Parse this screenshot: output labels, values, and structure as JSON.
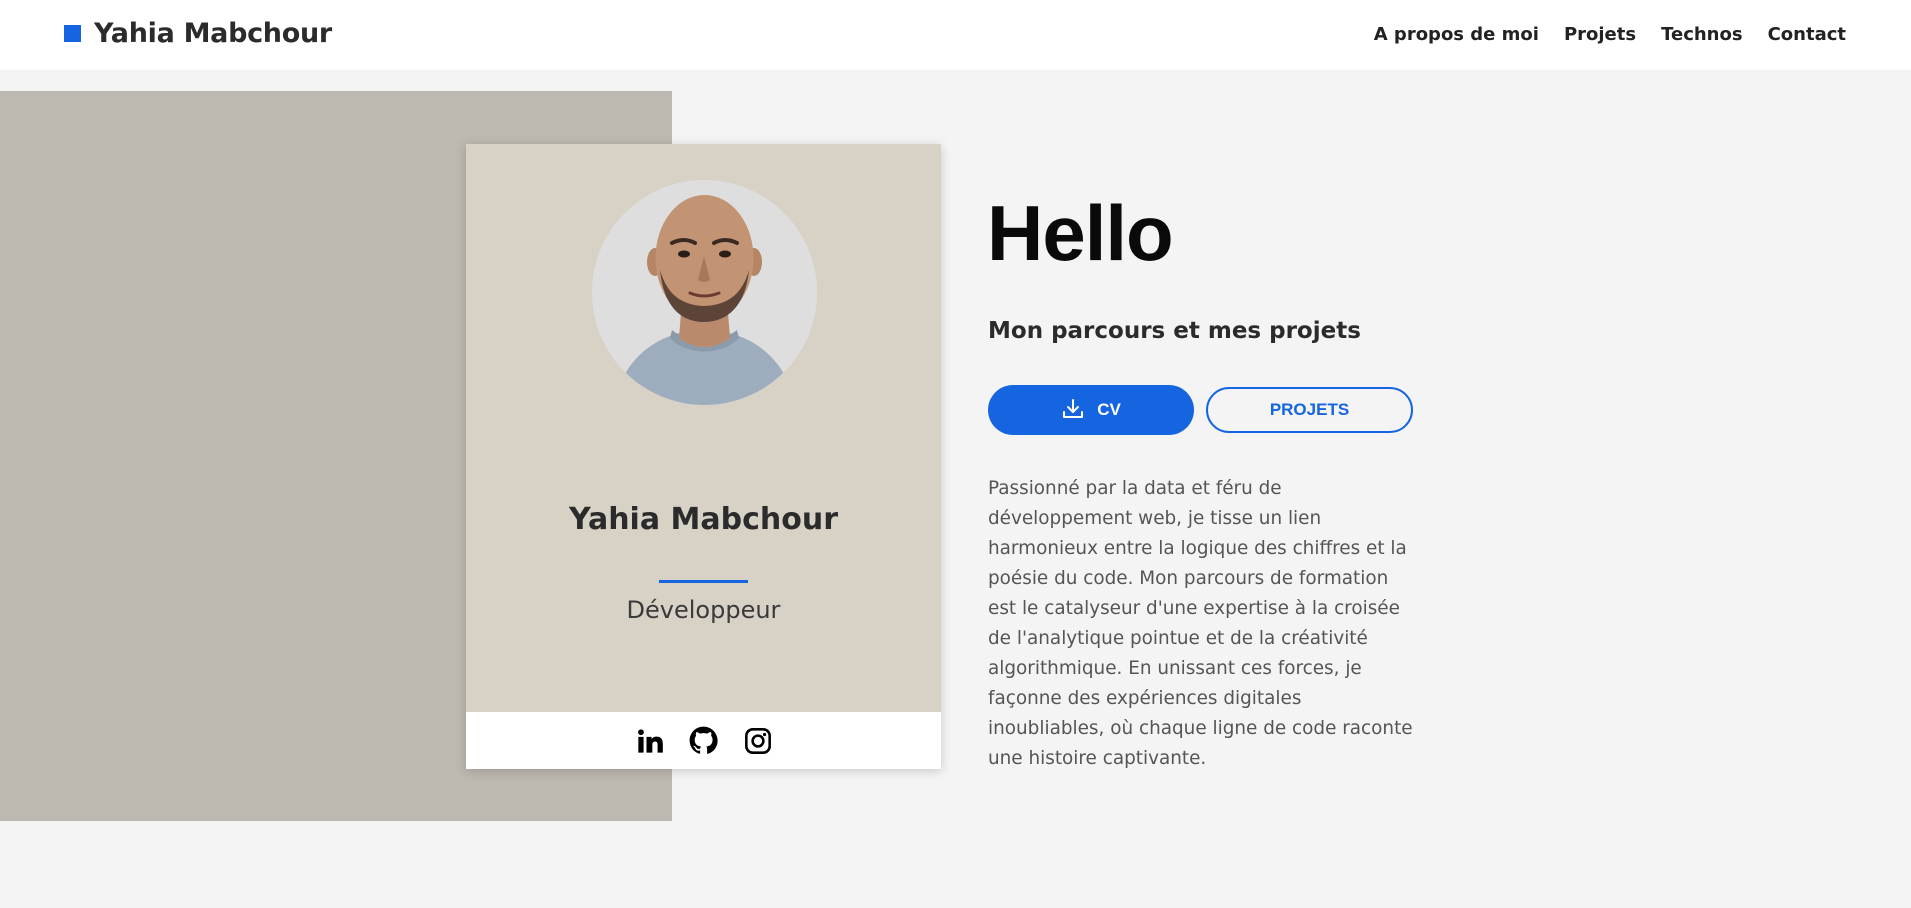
{
  "header": {
    "brand_name": "Yahia Mabchour",
    "nav": [
      "A propos de moi",
      "Projets",
      "Technos",
      "Contact"
    ]
  },
  "profile_card": {
    "name": "Yahia Mabchour",
    "role": "Développeur",
    "socials": [
      "linkedin-icon",
      "github-icon",
      "instagram-icon"
    ]
  },
  "hero": {
    "greeting": "Hello",
    "tagline": "Mon parcours et mes projets",
    "cv_button": "CV",
    "projects_button": "PROJETS",
    "bio": "Passionné par la data et féru de développement web, je tisse un lien harmonieux entre la logique des chiffres et la poésie du code. Mon parcours de formation est le catalyseur d'une expertise à la croisée de l'analytique pointue et de la créativité algorithmique. En unissant ces forces, je façonne des expériences digitales inoubliables, où chaque ligne de code raconte une histoire captivante."
  },
  "colors": {
    "accent": "#1565e0",
    "page_bg": "#f4f4f4",
    "hero_block": "#bdb9b1",
    "card_bg": "#d8d2c6"
  }
}
